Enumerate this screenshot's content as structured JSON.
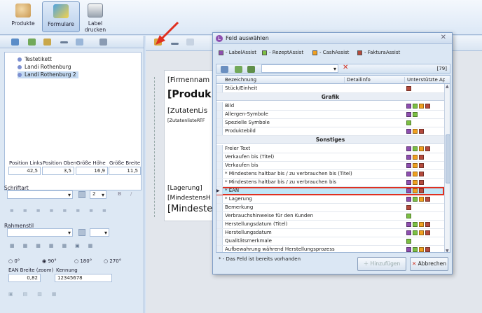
{
  "ribbon": {
    "buttons": [
      {
        "label": "Produkte",
        "icon": "products-icon"
      },
      {
        "label": "Formulare",
        "icon": "forms-icon"
      },
      {
        "label": "Label drucken",
        "icon": "printer-icon"
      }
    ]
  },
  "tree": {
    "items": [
      "Testetikett",
      "Landi Rothenburg",
      "Landi Rothenburg 2"
    ]
  },
  "position": {
    "labels": [
      "Position Links",
      "Position Oben",
      "Größe Höhe",
      "Größe Breite"
    ],
    "values": [
      "42,5",
      "3,5",
      "16,9",
      "11,5"
    ]
  },
  "font_section": {
    "label": "Schriftart",
    "size": "2"
  },
  "frame_section": {
    "label": "Rahmenstil"
  },
  "rotation": {
    "options": [
      "0°",
      "90°",
      "180°",
      "270°"
    ],
    "selected": "90°"
  },
  "ean": {
    "width_label": "EAN Breite (zoom)",
    "width_value": "0,82",
    "id_label": "Kennung",
    "id_value": "12345678"
  },
  "paper": {
    "lines": [
      "[Firmennam",
      "[Produk",
      "[ZutatenLis",
      "[ZutatenlisteRTF",
      "[Lagerung]",
      "[MindestensH",
      "[Mindeste"
    ]
  },
  "dialog": {
    "title": "Feld auswählen",
    "legend": [
      {
        "label": "- LabelAssist",
        "color": "#8e4fb0"
      },
      {
        "label": "- RezeptAssist",
        "color": "#7cc043"
      },
      {
        "label": "- CashAssist",
        "color": "#f0a020"
      },
      {
        "label": "- FakturaAssist",
        "color": "#b44a3c"
      }
    ],
    "count": "[79]",
    "columns": [
      "Bezeichnung",
      "Detailinfo",
      "Unterstützte App"
    ],
    "rows": [
      {
        "type": "row",
        "name": "Stück/Einheit",
        "marks": [
          "#b44a3c"
        ]
      },
      {
        "type": "group",
        "name": "Grafik"
      },
      {
        "type": "row",
        "name": "Bild",
        "marks": [
          "#8e4fb0",
          "#7cc043",
          "#f0a020",
          "#b44a3c"
        ]
      },
      {
        "type": "row",
        "name": "Allergen-Symbole",
        "marks": [
          "#8e4fb0",
          "#7cc043"
        ]
      },
      {
        "type": "row",
        "name": "Spezielle Symbole",
        "marks": [
          "#7cc043"
        ]
      },
      {
        "type": "row",
        "name": "Produktebild",
        "marks": [
          "#8e4fb0",
          "#f0a020",
          "#b44a3c"
        ]
      },
      {
        "type": "group",
        "name": "Sonstiges"
      },
      {
        "type": "row",
        "name": "Freier Text",
        "marks": [
          "#8e4fb0",
          "#7cc043",
          "#f0a020",
          "#b44a3c"
        ]
      },
      {
        "type": "row",
        "name": "Verkaufen bis (Titel)",
        "marks": [
          "#8e4fb0",
          "#f0a020",
          "#b44a3c"
        ]
      },
      {
        "type": "row",
        "name": "Verkaufen bis",
        "marks": [
          "#8e4fb0",
          "#f0a020",
          "#b44a3c"
        ]
      },
      {
        "type": "row",
        "name": "* Mindestens haltbar bis / zu verbrauchen bis (Titel)",
        "marks": [
          "#8e4fb0",
          "#f0a020",
          "#b44a3c"
        ]
      },
      {
        "type": "row",
        "name": "* Mindestens haltbar bis / zu verbrauchen bis",
        "marks": [
          "#8e4fb0",
          "#f0a020",
          "#b44a3c"
        ]
      },
      {
        "type": "row",
        "name": "* EAN",
        "marks": [
          "#8e4fb0",
          "#f0a020",
          "#b44a3c"
        ],
        "selected": true
      },
      {
        "type": "row",
        "name": "* Lagerung",
        "marks": [
          "#8e4fb0",
          "#7cc043",
          "#f0a020",
          "#b44a3c"
        ]
      },
      {
        "type": "row",
        "name": "Bemerkung",
        "marks": [
          "#b44a3c"
        ]
      },
      {
        "type": "row",
        "name": "Verbrauchshinweise für den Kunden",
        "marks": [
          "#7cc043"
        ]
      },
      {
        "type": "row",
        "name": "Herstellungsdatum (Titel)",
        "marks": [
          "#8e4fb0",
          "#7cc043",
          "#f0a020",
          "#b44a3c"
        ]
      },
      {
        "type": "row",
        "name": "Herstellungsdatum",
        "marks": [
          "#8e4fb0",
          "#7cc043",
          "#f0a020",
          "#b44a3c"
        ]
      },
      {
        "type": "row",
        "name": "Qualitätsmerkmale",
        "marks": [
          "#7cc043"
        ]
      },
      {
        "type": "row",
        "name": "Aufbewahrung während Herstellungsprozess",
        "marks": [
          "#8e4fb0",
          "#7cc043",
          "#f0a020",
          "#b44a3c"
        ]
      }
    ],
    "footnote": "* - Das Feld ist bereits vorhanden",
    "add_label": "Hinzufügen",
    "cancel_label": "Abbrechen"
  },
  "colors": {
    "accent_red": "#e03020",
    "selected_row": "#bfe6f7"
  }
}
